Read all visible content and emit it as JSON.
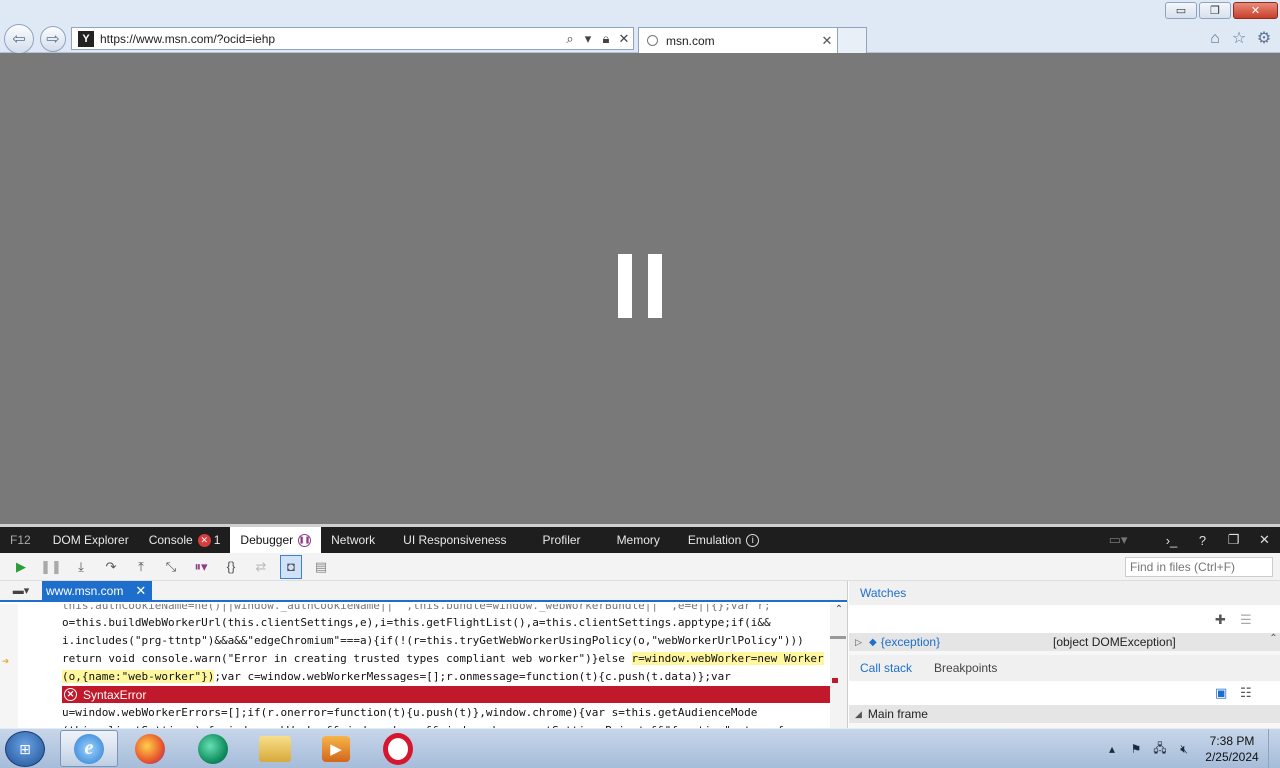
{
  "window": {
    "controls": {
      "minimize": "▭",
      "restore": "❐",
      "close": "✕"
    }
  },
  "address_bar": {
    "url": "https://www.msn.com/?ocid=iehp",
    "site_icon": "msn-favicon"
  },
  "tab": {
    "title": "msn.com",
    "close": "✕"
  },
  "page": {
    "overlay": "paused-in-debugger"
  },
  "devtools": {
    "tabs": [
      {
        "label": "F12"
      },
      {
        "label": "DOM Explorer"
      },
      {
        "label": "Console",
        "error_count": "1"
      },
      {
        "label": "Debugger"
      },
      {
        "label": "Network"
      },
      {
        "label": "UI Responsiveness"
      },
      {
        "label": "Profiler"
      },
      {
        "label": "Memory"
      },
      {
        "label": "Emulation"
      }
    ],
    "active_tab": "Debugger",
    "find_placeholder": "Find in files (Ctrl+F)",
    "file_tab": "www.msn.com",
    "code_lines": [
      "this.authCookieName=ne()||window._authCookieName||\"\",this.bundle=window._webWorkerBundle||\"\",e=e||{};var r;",
      "o=this.buildWebWorkerUrl(this.clientSettings,e),i=this.getFlightList(),a=this.clientSettings.apptype;if(i&&",
      "i.includes(\"prg-ttntp\")&&a&&\"edgeChromium\"===a){if(!(r=this.tryGetWebWorkerUsingPolicy(o,\"webWorkerUrlPolicy\")))",
      "return void console.warn(\"Error in creating trusted types compliant web worker\")}else ",
      "r=window.webWorker=new Worker",
      "(o,{name:\"web-worker\"})",
      ";var c=window.webWorkerMessages=[];r.onmessage=function(t){c.push(t.data)};var",
      "u=window.webWorkerErrors=[];if(r.onerror=function(t){u.push(t)},window.chrome){var s=this.getAudienceMode",
      "(this.clientSettings),f=window.webWorker&&window.chrome&&window.chrome.getSettingsPrivate&&\"function\"==typeof"
    ],
    "error_label": "SyntaxError",
    "watches": {
      "header": "Watches",
      "name": "{exception}",
      "value": "[object DOMException]"
    },
    "stack_tabs": [
      "Call stack",
      "Breakpoints"
    ],
    "main_frame": "Main frame"
  },
  "taskbar": {
    "apps": [
      "internet-explorer",
      "firefox",
      "edge-chromium",
      "file-explorer",
      "media-player",
      "opera"
    ],
    "time": "7:38 PM",
    "date": "2/25/2024"
  }
}
